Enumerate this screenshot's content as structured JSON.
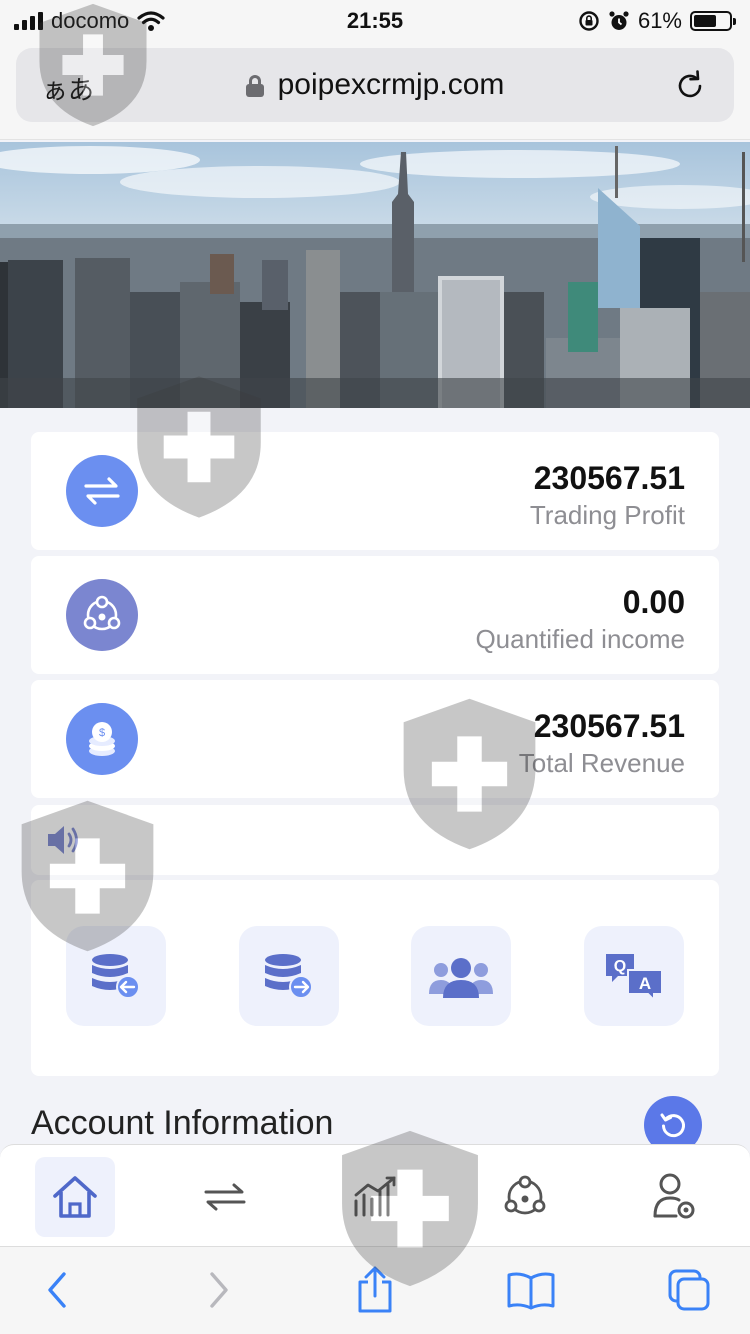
{
  "status_bar": {
    "carrier": "docomo",
    "time": "21:55",
    "battery": "61%"
  },
  "browser": {
    "aa_label": "ぁあ",
    "url": "poipexcrmjp.com"
  },
  "stats": [
    {
      "value": "230567.51",
      "label": "Trading Profit",
      "icon": "transfer-arrows-icon",
      "color": "#6b8ff0"
    },
    {
      "value": "0.00",
      "label": "Quantified income",
      "icon": "network-nodes-icon",
      "color": "#7b86d0"
    },
    {
      "value": "230567.51",
      "label": "Total Revenue",
      "icon": "coins-icon",
      "color": "#6b8ff0"
    }
  ],
  "notice": {
    "icon": "speaker-icon"
  },
  "actions": [
    {
      "name": "deposit",
      "icon": "database-in-icon"
    },
    {
      "name": "withdraw",
      "icon": "database-out-icon"
    },
    {
      "name": "team",
      "icon": "users-group-icon"
    },
    {
      "name": "faq",
      "icon": "qa-chat-icon"
    }
  ],
  "section": {
    "title": "Account Information"
  },
  "tabbar": [
    {
      "name": "home",
      "icon": "home-icon",
      "active": true
    },
    {
      "name": "trade",
      "icon": "transfer-arrows-icon",
      "active": false
    },
    {
      "name": "markets",
      "icon": "chart-trend-icon",
      "active": false
    },
    {
      "name": "quant",
      "icon": "network-nodes-icon",
      "active": false
    },
    {
      "name": "profile",
      "icon": "user-settings-icon",
      "active": false
    }
  ],
  "colors": {
    "accent": "#5b78e8",
    "icon_line": "#5b6fc9",
    "light_fill": "#eef1fc"
  }
}
